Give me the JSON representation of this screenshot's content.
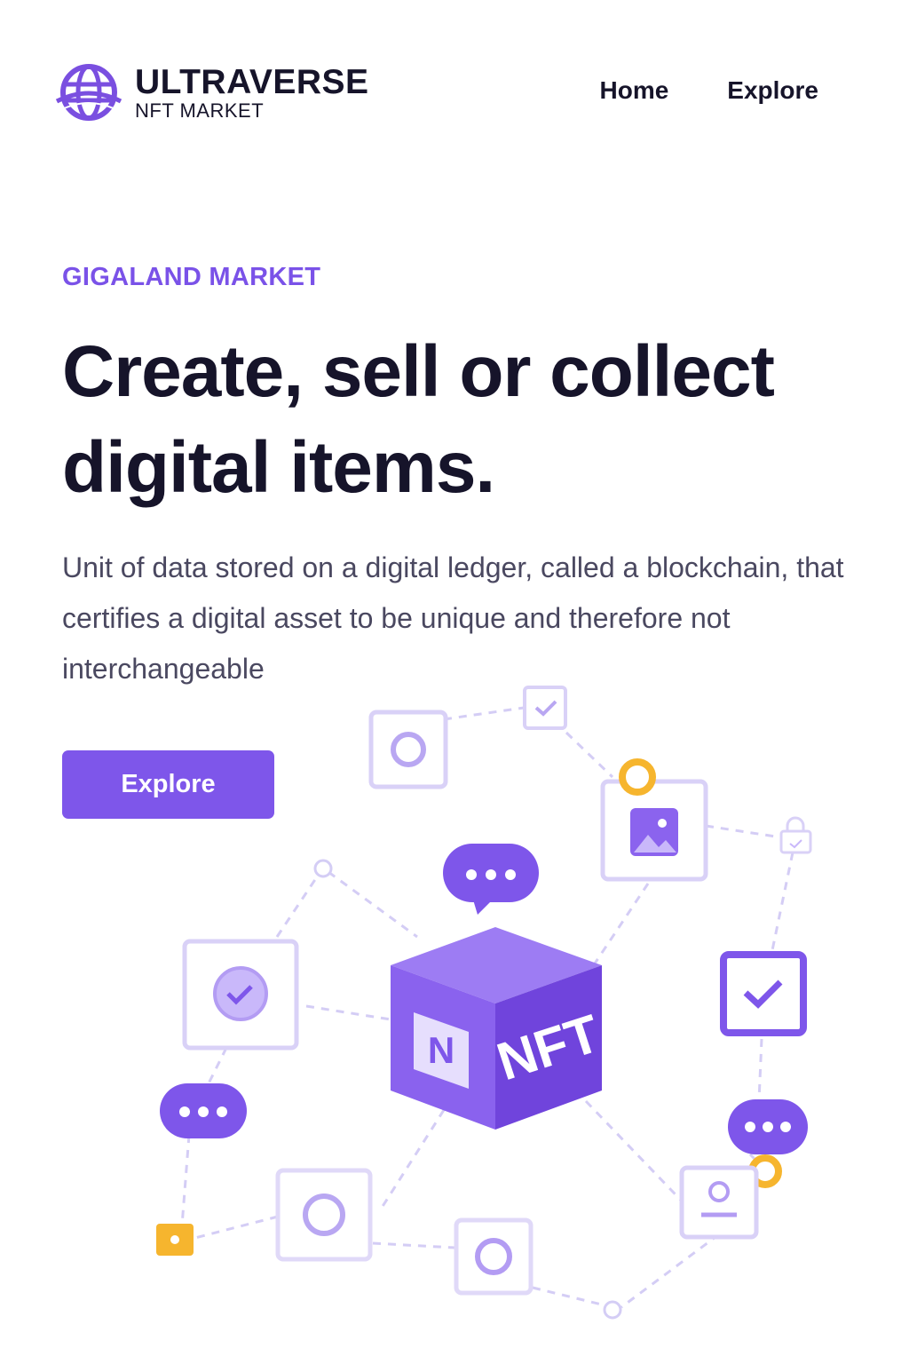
{
  "brand": {
    "name": "ULTRAVERSE",
    "subtitle": "NFT MARKET",
    "icon": "globe-icon",
    "accent_color": "#7e56ea"
  },
  "nav": {
    "items": [
      {
        "label": "Home"
      },
      {
        "label": "Explore"
      }
    ]
  },
  "hero": {
    "eyebrow": "GIGALAND MARKET",
    "headline_line1": "Create, sell or collect",
    "headline_line2": "digital items.",
    "description": "Unit of data stored on a digital ledger, called a blockchain, that certifies a digital asset to be unique and therefore not interchangeable",
    "cta_label": "Explore"
  },
  "illustration": {
    "cube_face_letter": "N",
    "cube_label": "NFT",
    "icons": [
      "nft-cube-icon",
      "chat-bubble-icon",
      "image-icon",
      "checkmark-icon",
      "lock-icon",
      "user-card-icon",
      "circle-node-icon"
    ]
  }
}
